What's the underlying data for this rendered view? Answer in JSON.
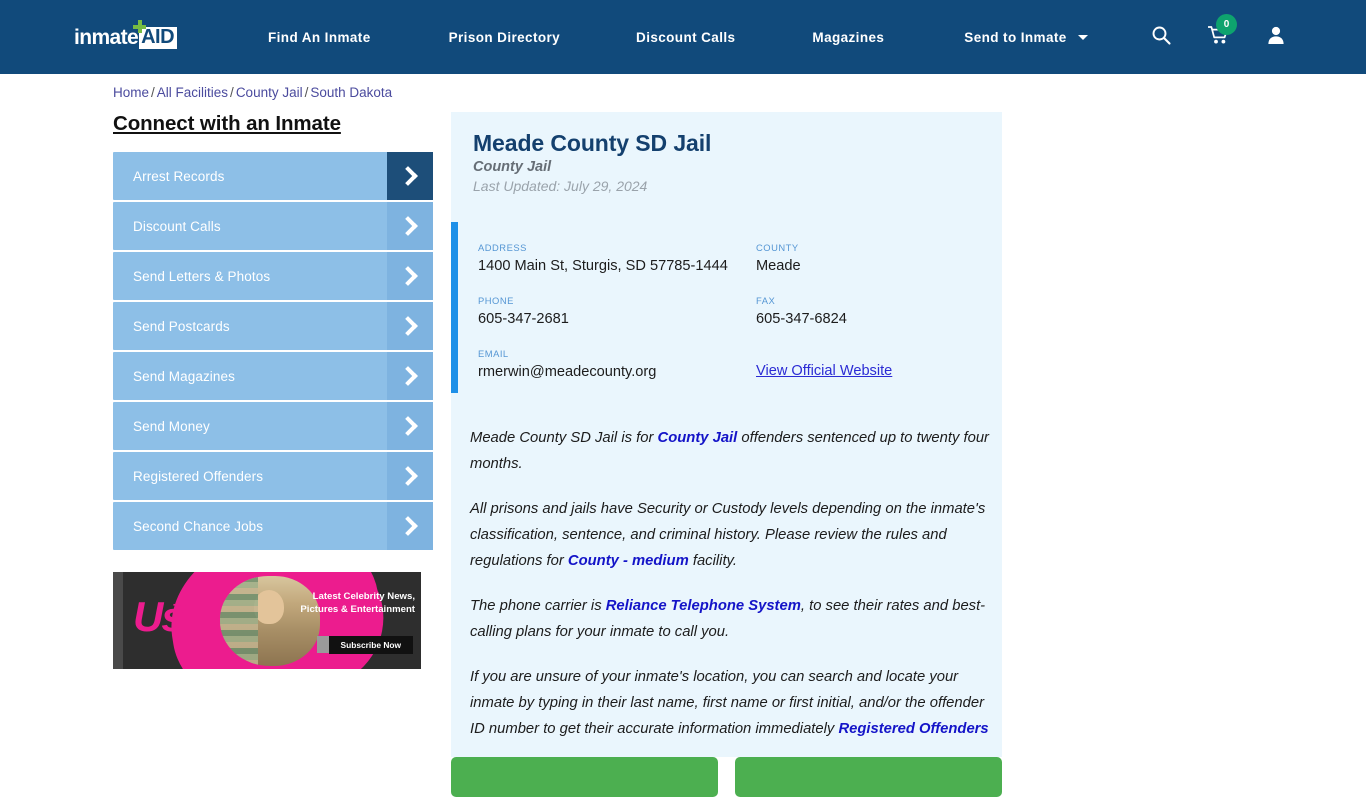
{
  "header": {
    "logo": {
      "word": "inmate",
      "badge": "AID"
    },
    "nav": [
      {
        "label": "Find An Inmate"
      },
      {
        "label": "Prison Directory"
      },
      {
        "label": "Discount Calls"
      },
      {
        "label": "Magazines"
      },
      {
        "label": "Send to Inmate",
        "has_caret": true
      }
    ],
    "icons": {
      "search": "search-icon",
      "cart": "cart-icon",
      "cart_count": "0",
      "account": "user-icon"
    },
    "colors": {
      "bar": "#114a7b",
      "badge": "#0ea36e"
    }
  },
  "breadcrumb": {
    "items": [
      "Home",
      "All Facilities",
      "County Jail",
      "South Dakota"
    ],
    "separator": "/"
  },
  "sidebar": {
    "title": "Connect with an Inmate",
    "items": [
      {
        "label": "Arrest Records"
      },
      {
        "label": "Discount Calls"
      },
      {
        "label": "Send Letters & Photos"
      },
      {
        "label": "Send Postcards"
      },
      {
        "label": "Send Magazines"
      },
      {
        "label": "Send Money"
      },
      {
        "label": "Registered Offenders"
      },
      {
        "label": "Second Chance Jobs"
      }
    ],
    "ad": {
      "brand": "Us",
      "headline": "Latest Celebrity News, Pictures & Entertainment",
      "cta": "Subscribe Now"
    }
  },
  "facility": {
    "name": "Meade County SD Jail",
    "type": "County Jail",
    "last_updated": "Last Updated: July 29, 2024",
    "contact": {
      "address_label": "ADDRESS",
      "address_value": "1400 Main St, Sturgis, SD 57785-1444",
      "county_label": "COUNTY",
      "county_value": "Meade",
      "phone_label": "PHONE",
      "phone_value": "605-347-2681",
      "fax_label": "FAX",
      "fax_value": "605-347-6824",
      "email_label": "EMAIL",
      "email_value": "rmerwin@meadecounty.org",
      "website_link": "View Official Website"
    },
    "paragraphs": {
      "p1_a": "Meade County SD Jail is for ",
      "p1_hl": "County Jail",
      "p1_b": " offenders sentenced up to twenty four months.",
      "p2_a": "All prisons and jails have Security or Custody levels depending on the inmate's classification, sentence, and criminal history. Please review the rules and regulations for ",
      "p2_hl": "County - medium",
      "p2_b": " facility.",
      "p3_a": "The phone carrier is ",
      "p3_hl": "Reliance Telephone System",
      "p3_b": ", to see their rates and best-calling plans for your inmate to call you.",
      "p4_a": "If you are unsure of your inmate's location, you can search and locate your inmate by typing in their last name, first name or first initial, and/or the offender ID number to get their accurate information immediately ",
      "p4_hl": "Registered Offenders"
    }
  },
  "actions": {
    "button_left": "",
    "button_right": ""
  }
}
